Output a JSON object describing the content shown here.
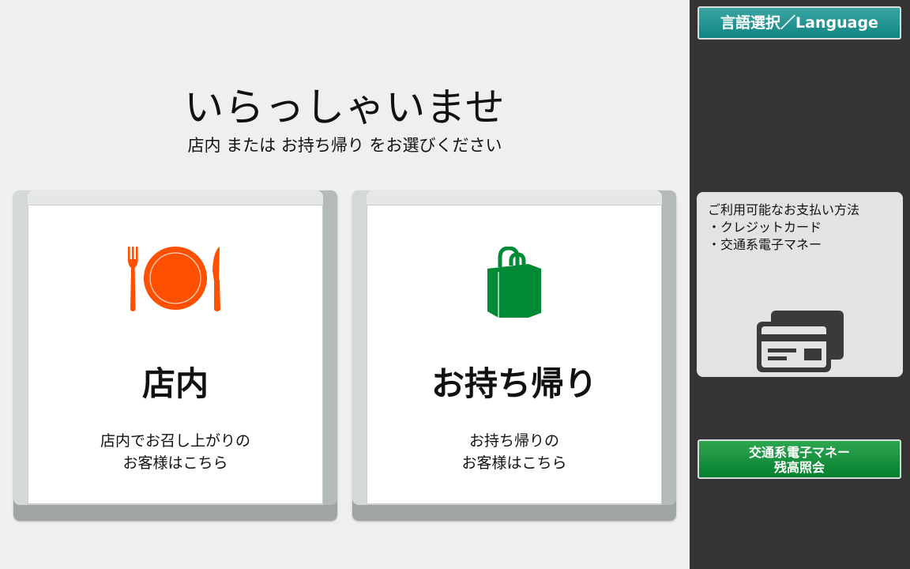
{
  "header": {
    "welcome": "いらっしゃいませ",
    "instruction": "店内 または お持ち帰り をお選びください"
  },
  "choices": {
    "eat_in": {
      "icon": "plate-cutlery-icon",
      "label": "店内",
      "desc_line1": "店内でお召し上がりの",
      "desc_line2": "お客様はこちら",
      "icon_color": "#ff4f00"
    },
    "takeout": {
      "icon": "shopping-bag-icon",
      "label": "お持ち帰り",
      "desc_line1": "お持ち帰りの",
      "desc_line2": "お客様はこちら",
      "icon_color": "#008a36"
    }
  },
  "sidebar": {
    "language_button": "言語選択／Language",
    "payment": {
      "title": "ご利用可能なお支払い方法",
      "method1": "・クレジットカード",
      "method2": "・交通系電子マネー",
      "icon": "credit-card-icon"
    },
    "balance_button_line1": "交通系電子マネー",
    "balance_button_line2": "残高照会"
  },
  "colors": {
    "teal_button": "#138a87",
    "green_button": "#0a8434",
    "sidebar_bg": "#343434"
  }
}
